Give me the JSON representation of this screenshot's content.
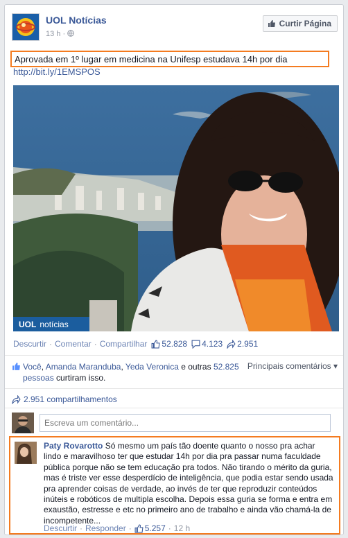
{
  "post": {
    "page_name": "UOL Notícias",
    "time": "13 h",
    "like_page_button": "Curtir Página",
    "text": "Aprovada em 1º lugar em medicina na Unifesp estudava 14h por dia",
    "link": "http://bit.ly/1EMSPOS",
    "photo_brand": "notícias",
    "photo_brand_logo": "UOL",
    "actions": {
      "unlike": "Descurtir",
      "comment": "Comentar",
      "share": "Compartilhar"
    },
    "counts": {
      "likes": "52.828",
      "comments": "4.123",
      "shares": "2.951"
    }
  },
  "likes_summary": {
    "you": "Você",
    "person1": "Amanda Maranduba",
    "person2": "Yeda Veronica",
    "and_others": "e outras",
    "others_count": "52.825 pessoas",
    "tail": "curtiram isso.",
    "top_comments": "Principais comentários ▾"
  },
  "shares_summary": "2.951 compartilhamentos",
  "composer": {
    "placeholder": "Escreva um comentário..."
  },
  "comment": {
    "author": "Paty Rovarotto",
    "text": "Só mesmo um país tão doente quanto o nosso pra achar lindo e maravilhoso ter que estudar 14h por dia pra passar numa faculdade pública porque não se tem educação pra todos. Não tirando o mérito da guria, mas é triste ver esse desperdício de inteligência, que podia estar sendo usada pra aprender coisas de verdade, ao invés de ter que reproduzir conteúdos inúteis e robóticos de multipla escolha. Depois essa guria se forma e entra em exaustão, estresse e etc no primeiro ano de trabalho e ainda vão chamá-la de incompetente...",
    "unlike": "Descurtir",
    "reply": "Responder",
    "likes": "5.257",
    "time": "12 h"
  },
  "colors": {
    "brand_blue": "#3b5998",
    "highlight_orange": "#f47b20",
    "uol_blue": "#1a5fa8"
  }
}
